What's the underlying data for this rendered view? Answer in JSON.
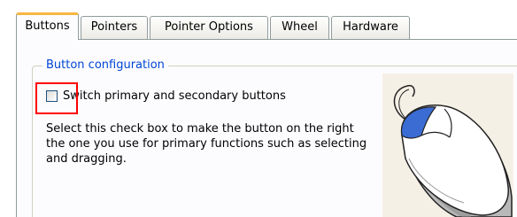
{
  "tabs": [
    {
      "label": "Buttons",
      "active": true
    },
    {
      "label": "Pointers",
      "active": false
    },
    {
      "label": "Pointer Options",
      "active": false
    },
    {
      "label": "Wheel",
      "active": false
    },
    {
      "label": "Hardware",
      "active": false
    }
  ],
  "button_configuration": {
    "group_title": "Button configuration",
    "checkbox": {
      "label": "Switch primary and secondary buttons",
      "checked": false
    },
    "description": "Select this check box to make the button on the right the one you use for primary functions such as selecting and dragging."
  },
  "illustration": {
    "icon": "mouse-icon",
    "highlighted_button": "left",
    "highlight_color": "#3a6cd4"
  },
  "annotation": {
    "color": "#ff0000"
  },
  "colors": {
    "active_tab_accent": "#f7b641",
    "group_title": "#0046d5",
    "border": "#919b9c"
  }
}
